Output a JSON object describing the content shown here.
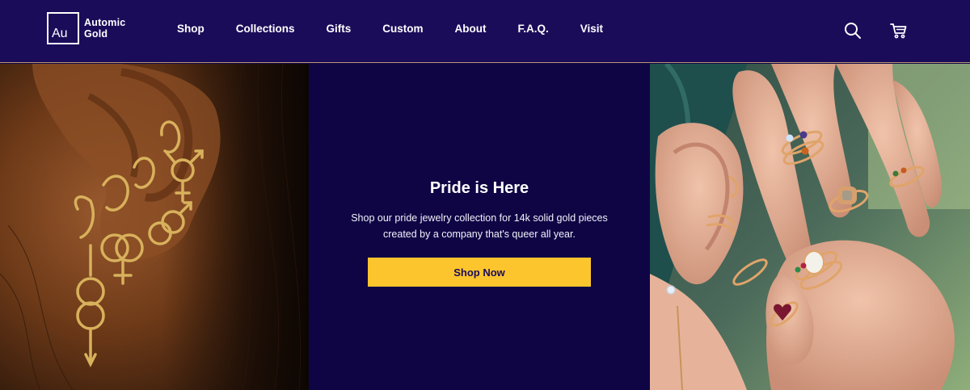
{
  "brand": {
    "symbol": "Au",
    "name_line1": "Automic",
    "name_line2": "Gold"
  },
  "nav": {
    "items": [
      {
        "label": "Shop"
      },
      {
        "label": "Collections"
      },
      {
        "label": "Gifts"
      },
      {
        "label": "Custom"
      },
      {
        "label": "About"
      },
      {
        "label": "F.A.Q."
      },
      {
        "label": "Visit"
      }
    ]
  },
  "header_icons": {
    "search": "search-icon",
    "cart": "cart-icon"
  },
  "hero": {
    "title": "Pride is Here",
    "text": "Shop our pride jewelry collection for 14k solid gold pieces created by a company that's queer all year.",
    "cta_label": "Shop Now"
  },
  "colors": {
    "header_bg": "#1b0c5a",
    "hero_bg": "#0f0545",
    "accent": "#fcc52d",
    "divider": "#b99872"
  }
}
